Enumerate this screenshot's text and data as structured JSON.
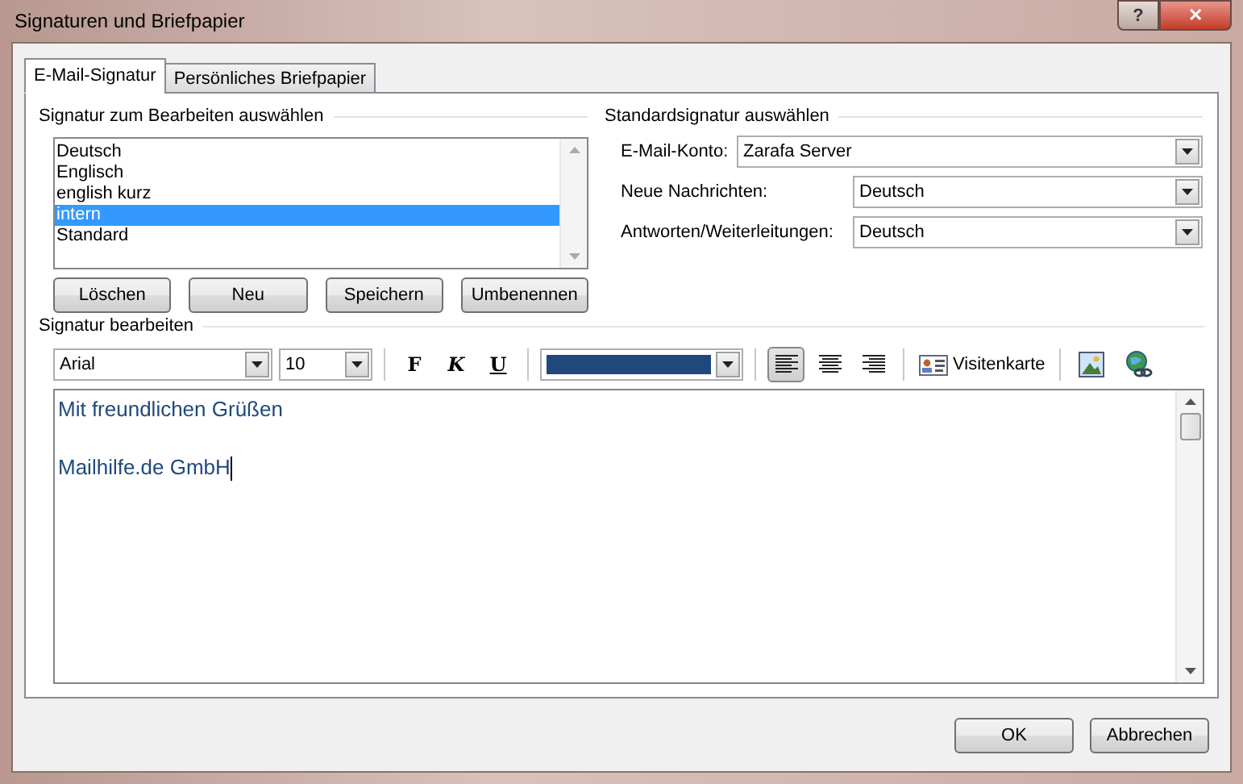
{
  "window": {
    "title": "Signaturen und Briefpapier",
    "help_glyph": "?",
    "close_glyph": "✕"
  },
  "tabs": [
    {
      "label": "E-Mail-Signatur",
      "selected": true
    },
    {
      "label": "Persönliches Briefpapier",
      "selected": false
    }
  ],
  "select_section": {
    "heading": "Signatur zum Bearbeiten auswählen",
    "signatures": [
      {
        "label": "Deutsch",
        "selected": false
      },
      {
        "label": "Englisch",
        "selected": false
      },
      {
        "label": "english kurz",
        "selected": false
      },
      {
        "label": "intern",
        "selected": true
      },
      {
        "label": "Standard",
        "selected": false
      }
    ],
    "buttons": [
      "Löschen",
      "Neu",
      "Speichern",
      "Umbenennen"
    ]
  },
  "default_section": {
    "heading": "Standardsignatur auswählen",
    "fields": [
      {
        "label": "E-Mail-Konto:",
        "value": "Zarafa Server",
        "kind": "wide"
      },
      {
        "label": "Neue Nachrichten:",
        "value": "Deutsch",
        "kind": "narrow"
      },
      {
        "label": "Antworten/Weiterleitungen:",
        "value": "Deutsch",
        "kind": "narrow"
      }
    ]
  },
  "edit_section": {
    "heading": "Signatur bearbeiten",
    "toolbar": {
      "font": "Arial",
      "size": "10",
      "bold": "F",
      "italic": "K",
      "underline": "U",
      "alignments": [
        {
          "kind": "left",
          "selected": true
        },
        {
          "kind": "center",
          "selected": false
        },
        {
          "kind": "right",
          "selected": false
        }
      ],
      "business_card": "Visitenkarte"
    },
    "lines": [
      "Mit freundlichen Grüßen",
      "Mailhilfe.de GmbH"
    ]
  },
  "footer": {
    "buttons": [
      "OK",
      "Abbrechen"
    ]
  }
}
